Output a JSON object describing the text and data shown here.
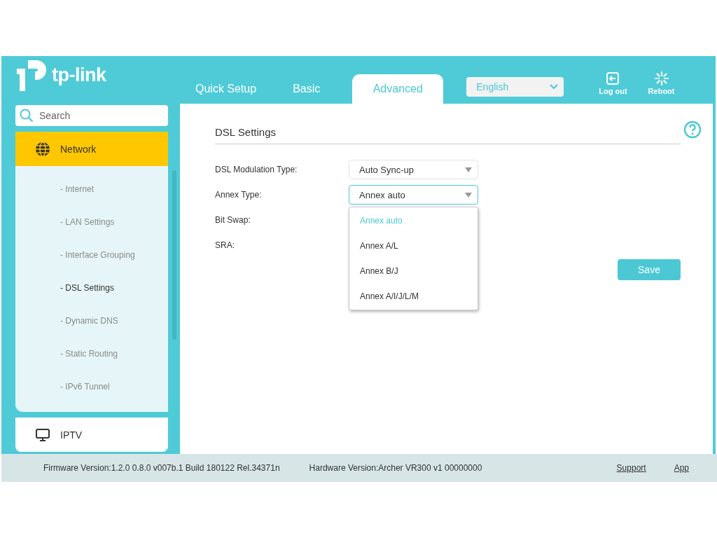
{
  "logo": {
    "text": "tp-link"
  },
  "nav_tabs": [
    {
      "label": "Quick Setup",
      "selected": false
    },
    {
      "label": "Basic",
      "selected": false
    },
    {
      "label": "Advanced",
      "selected": true
    }
  ],
  "language": {
    "value": "English"
  },
  "header_actions": [
    {
      "kind": "logout",
      "label": "Log out"
    },
    {
      "kind": "reboot",
      "label": "Reboot"
    }
  ],
  "sidebar": {
    "search": {
      "placeholder": "Search"
    },
    "items": [
      {
        "kind": "network",
        "label": "Network",
        "expanded": true,
        "children": [
          {
            "label": "- Internet",
            "selected": false
          },
          {
            "label": "- LAN Settings",
            "selected": false
          },
          {
            "label": "- Interface Grouping",
            "selected": false
          },
          {
            "label": "- DSL Settings",
            "selected": true
          },
          {
            "label": "- Dynamic DNS",
            "selected": false
          },
          {
            "label": "- Static Routing",
            "selected": false
          },
          {
            "label": "- IPv6 Tunnel",
            "selected": false
          }
        ]
      },
      {
        "kind": "tv",
        "label": "IPTV",
        "expanded": false
      }
    ]
  },
  "section": {
    "title": "DSL Settings"
  },
  "fields": [
    {
      "label": "DSL Modulation Type:",
      "value": "Auto Sync-up",
      "open": false
    },
    {
      "label": "Annex Type:",
      "value": "Annex auto",
      "open": true,
      "options": [
        {
          "label": "Annex auto",
          "selected": true
        },
        {
          "label": "Annex A/L",
          "selected": false
        },
        {
          "label": "Annex B/J",
          "selected": false
        },
        {
          "label": "Annex A/I/J/L/M",
          "selected": false
        }
      ]
    },
    {
      "label": "Bit Swap:"
    },
    {
      "label": "SRA:"
    }
  ],
  "save_button": "Save",
  "footer": {
    "firmware": "Firmware Version:1.2.0 0.8.0 v007b.1 Build 180122 Rel.34371n",
    "hardware": "Hardware Version:Archer VR300 v1 00000000",
    "links": [
      "Support",
      "App"
    ]
  }
}
